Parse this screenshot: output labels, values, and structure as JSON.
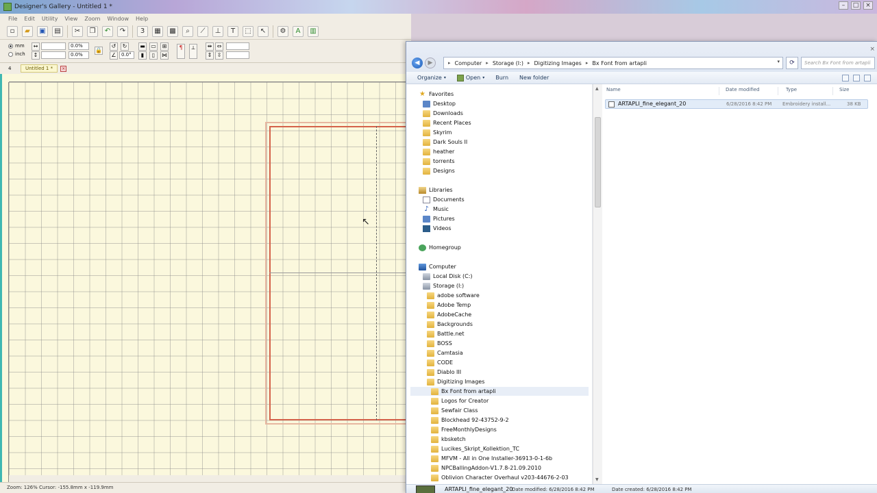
{
  "designer": {
    "title": "Designer's Gallery - Untitled 1 *",
    "menu": [
      "File",
      "Edit",
      "Utility",
      "View",
      "Zoom",
      "Window",
      "Help"
    ],
    "units": {
      "mm": "mm",
      "inch": "inch"
    },
    "fields": {
      "width": "0.0%",
      "height": "0.0%",
      "rotation": "0.0°"
    },
    "doc_tab": "Untitled 1 *",
    "doc_number": "4",
    "status": "Zoom: 126%  Cursor: -155.8mm x -119.9mm"
  },
  "explorer": {
    "breadcrumb": [
      "Computer",
      "Storage (I:)",
      "Digitizing Images",
      "Bx Font from artapli"
    ],
    "search_placeholder": "Search Bx Font from artapli",
    "commands": {
      "organize": "Organize",
      "open": "Open",
      "burn": "Burn",
      "new_folder": "New folder"
    },
    "favorites": {
      "header": "Favorites",
      "items": [
        "Desktop",
        "Downloads",
        "Recent Places",
        "Skyrim",
        "Dark Souls II",
        "heather",
        "torrents",
        "Designs"
      ]
    },
    "libraries": {
      "header": "Libraries",
      "items": [
        "Documents",
        "Music",
        "Pictures",
        "Videos"
      ]
    },
    "homegroup": "Homegroup",
    "computer": {
      "header": "Computer",
      "drives": [
        "Local Disk (C:)",
        "Storage (I:)"
      ],
      "storage_folders": [
        "adobe software",
        "Adobe Temp",
        "AdobeCache",
        "Backgrounds",
        "Battle.net",
        "BOSS",
        "Camtasia",
        "CODE",
        "Diablo III",
        "Digitizing Images"
      ],
      "digitizing_children": [
        "Bx Font from artapli",
        "Logos for Creator",
        "Sewfair Class",
        "Blockhead 92-43752-9-2",
        "FreeMonthlyDesigns",
        "kbsketch",
        "Lucikes_Skript_Kollektion_TC",
        "MFVM - All in One Installer-36913-0-1-6b",
        "NPCBallingAddon-V1.7.8-21.09.2010",
        "Oblivion Character Overhaul v203-44676-2-03"
      ]
    },
    "columns": {
      "name": "Name",
      "date": "Date modified",
      "type": "Type",
      "size": "Size"
    },
    "files": [
      {
        "name": "ARTAPLI_fine_elegant_20",
        "date": "6/28/2016 8:42 PM",
        "type": "Embroidery install...",
        "size": "38 KB"
      }
    ],
    "details": {
      "name": "ARTAPLI_fine_elegant_20",
      "modified": "Date modified: 6/28/2016 8:42 PM",
      "created": "Date created: 6/28/2016 8:42 PM"
    }
  }
}
